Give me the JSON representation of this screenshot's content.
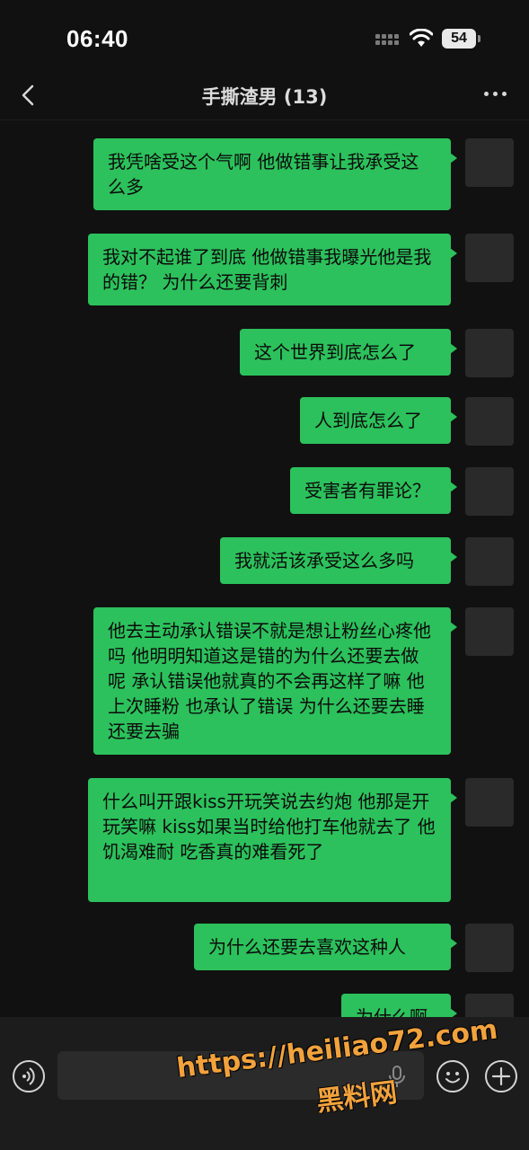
{
  "status_bar": {
    "time": "06:40",
    "battery": "54"
  },
  "header": {
    "title": "手撕渣男 (13)"
  },
  "messages": [
    {
      "text": "我凭啥受这个气啊 他做错事让我承受这么多"
    },
    {
      "text": "我对不起谁了到底  他做错事我曝光他是我的错？ 为什么还要背刺"
    },
    {
      "text": "这个世界到底怎么了"
    },
    {
      "text": "人到底怎么了"
    },
    {
      "text": "受害者有罪论？"
    },
    {
      "text": "我就活该承受这么多吗"
    },
    {
      "text": "他去主动承认错误不就是想让粉丝心疼他吗 他明明知道这是错的为什么还要去做呢 承认错误他就真的不会再这样了嘛 他上次睡粉 也承认了错误 为什么还要去睡还要去骗"
    },
    {
      "text": "什么叫开跟kiss开玩笑说去约炮 他那是开玩笑嘛 kiss如果当时给他打车他就去了 他饥渴难耐 吃香真的难看死了"
    },
    {
      "text": "为什么还要去喜欢这种人"
    },
    {
      "text": "为什么啊"
    }
  ],
  "input_bar": {
    "value": ""
  },
  "watermark": {
    "url": "https://heiliao72.com",
    "name": "黑料网"
  },
  "colors": {
    "bubble": "#2cc15c",
    "background": "#111111",
    "watermark": "#f2a23c"
  },
  "icons": [
    "back-icon",
    "more-icon",
    "voice-icon",
    "mic-icon",
    "emoji-icon",
    "plus-icon",
    "wifi-icon",
    "signal-icon",
    "battery-icon"
  ]
}
